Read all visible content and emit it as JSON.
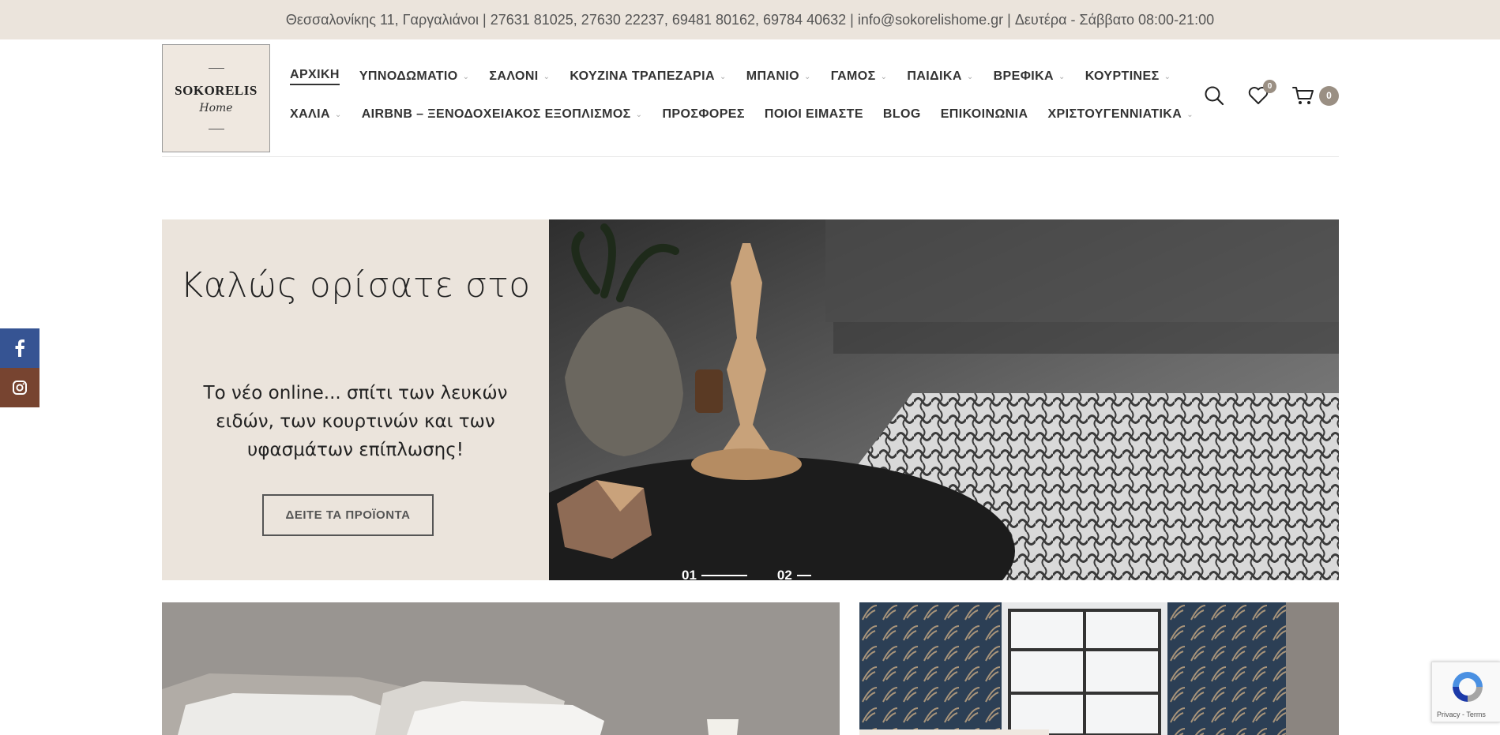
{
  "topbar": {
    "info": "Θεσσαλονίκης 11, Γαργαλιάνοι | 27631 81025, 27630 22237, 69481 80162, 69784 40632 | info@sokorelishome.gr | Δευτέρα - Σάββατο 08:00-21:00"
  },
  "logo": {
    "brand": "SOKORELIS",
    "script": "Home"
  },
  "nav": {
    "row1": [
      {
        "label": "ΑΡΧΙΚΗ",
        "active": true,
        "dropdown": false
      },
      {
        "label": "ΥΠΝΟΔΩΜΑΤΙΟ",
        "dropdown": true
      },
      {
        "label": "ΣΑΛΟΝΙ",
        "dropdown": true
      },
      {
        "label": "ΚΟΥΖΙΝΑ ΤΡΑΠΕΖΑΡΙΑ",
        "dropdown": true
      },
      {
        "label": "ΜΠΑΝΙΟ",
        "dropdown": true
      },
      {
        "label": "ΓΑΜΟΣ",
        "dropdown": true
      },
      {
        "label": "ΠΑΙΔΙΚΑ",
        "dropdown": true
      },
      {
        "label": "ΒΡΕΦΙΚΑ",
        "dropdown": true
      },
      {
        "label": "ΚΟΥΡΤΙΝΕΣ",
        "dropdown": true
      }
    ],
    "row2": [
      {
        "label": "ΧΑΛΙΑ",
        "dropdown": true
      },
      {
        "label": "AIRBNB – ΞΕΝΟΔΟΧΕΙΑΚΟΣ ΕΞΟΠΛΙΣΜΟΣ",
        "dropdown": true
      },
      {
        "label": "ΠΡΟΣΦΟΡΕΣ",
        "dropdown": false
      },
      {
        "label": "ΠΟΙΟΙ ΕΙΜΑΣΤΕ",
        "dropdown": false
      },
      {
        "label": "BLOG",
        "dropdown": false
      },
      {
        "label": "ΕΠΙΚΟΙΝΩΝΙΑ",
        "dropdown": false
      },
      {
        "label": "ΧΡΙΣΤΟΥΓΕΝΝΙΑΤΙΚΑ",
        "dropdown": true
      }
    ]
  },
  "tools": {
    "wishlist_count": "0",
    "cart_count": "0"
  },
  "hero": {
    "title": "Καλώς ορίσατε στο",
    "subtitle": "Το νέο online... σπίτι των λευκών ειδών, των κουρτινών και των υφασμάτων επίπλωσης!",
    "button": "ΔΕΙΤΕ ΤΑ ΠΡΟΪΟΝΤΑ",
    "slides": [
      "01",
      "02"
    ],
    "active_slide": 0
  },
  "recaptcha": {
    "terms": "Privacy - Terms"
  },
  "colors": {
    "accent": "#ebe4dc",
    "facebook": "#365493",
    "instagram": "#774430",
    "badge": "#9a8f83"
  },
  "icons": {
    "search": "search-icon",
    "wishlist": "heart-icon",
    "cart": "cart-icon",
    "facebook": "facebook-icon",
    "instagram": "instagram-icon"
  }
}
